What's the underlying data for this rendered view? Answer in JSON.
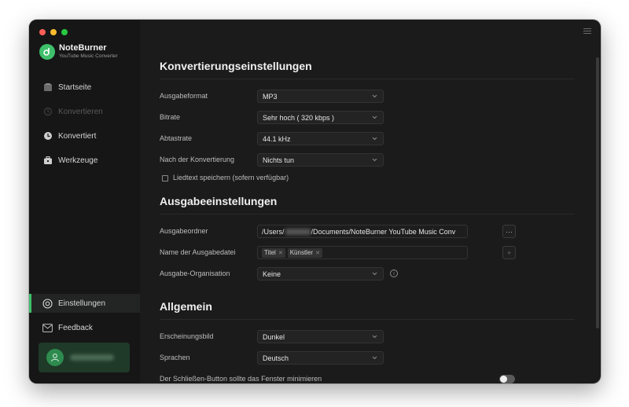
{
  "app": {
    "name": "NoteBurner",
    "subtitle": "YouTube Music Converter"
  },
  "sidebar": {
    "items": [
      {
        "id": "home",
        "label": "Startseite",
        "icon": "home-icon"
      },
      {
        "id": "convert",
        "label": "Konvertieren",
        "icon": "convert-icon",
        "disabled": true
      },
      {
        "id": "converted",
        "label": "Konvertiert",
        "icon": "clock-icon"
      },
      {
        "id": "tools",
        "label": "Werkzeuge",
        "icon": "toolbox-icon"
      }
    ],
    "bottom": [
      {
        "id": "settings",
        "label": "Einstellungen",
        "icon": "gear-icon",
        "active": true
      },
      {
        "id": "feedback",
        "label": "Feedback",
        "icon": "mail-icon"
      }
    ]
  },
  "conversion": {
    "title": "Konvertierungseinstellungen",
    "format": {
      "label": "Ausgabeformat",
      "value": "MP3"
    },
    "bitrate": {
      "label": "Bitrate",
      "value": "Sehr hoch ( 320 kbps )"
    },
    "samplerate": {
      "label": "Abtastrate",
      "value": "44.1 kHz"
    },
    "after": {
      "label": "Nach der Konvertierung",
      "value": "Nichts tun"
    },
    "lyrics": {
      "label": "Liedtext speichern (sofern verfügbar)",
      "checked": false
    }
  },
  "output": {
    "title": "Ausgabeeinstellungen",
    "folder": {
      "label": "Ausgabeordner",
      "prefix": "/Users/",
      "suffix": "/Documents/NoteBurner YouTube Music Conv",
      "browse": "···"
    },
    "filename": {
      "label": "Name der Ausgabedatei",
      "tags": [
        "Titel",
        "Künstler"
      ],
      "add": "+"
    },
    "organization": {
      "label": "Ausgabe-Organisation",
      "value": "Keine",
      "info": "i"
    }
  },
  "general": {
    "title": "Allgemein",
    "appearance": {
      "label": "Erscheinungsbild",
      "value": "Dunkel"
    },
    "language": {
      "label": "Sprachen",
      "value": "Deutsch"
    },
    "minimize": {
      "label": "Der Schließen-Button sollte das Fenster minimieren",
      "on": false
    }
  },
  "colors": {
    "accent": "#3fbf6a",
    "background": "#1b1b1c",
    "sidebar": "#161617"
  }
}
